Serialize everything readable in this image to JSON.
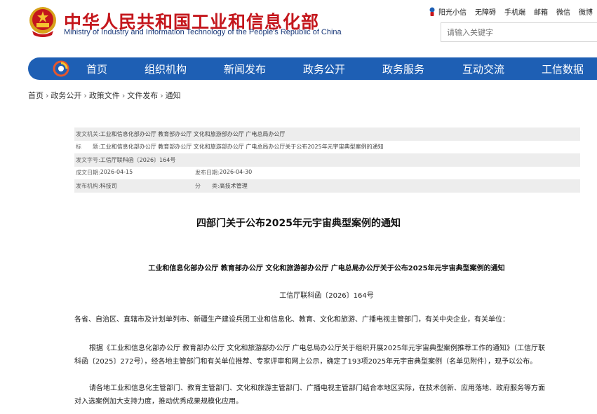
{
  "header": {
    "title_cn": "中华人民共和国工业和信息化部",
    "title_en": "Ministry of Industry and Information Technology of the People's Republic of China",
    "toplinks": [
      "阳光小信",
      "无障碍",
      "手机端",
      "邮箱",
      "微信",
      "微博"
    ],
    "search_placeholder": "请输入关键字"
  },
  "nav": {
    "items": [
      "首页",
      "组织机构",
      "新闻发布",
      "政务公开",
      "政务服务",
      "互动交流",
      "工信数据"
    ]
  },
  "breadcrumb": [
    "首页",
    "政务公开",
    "政策文件",
    "文件发布",
    "通知"
  ],
  "meta": {
    "issuer_label": "发文机关:",
    "issuer": "工业和信息化部办公厅 教育部办公厅 文化和旅游部办公厅 广电总局办公厅",
    "title_label": "标　　题:",
    "title": "工业和信息化部办公厅 教育部办公厅 文化和旅游部办公厅 广电总局办公厅关于公布2025年元宇宙典型案例的通知",
    "docno_label": "发文字号:",
    "docno": "工信厅联科函〔2026〕164号",
    "created_label": "成文日期:",
    "created": "2026-04-15",
    "published_label": "发布日期:",
    "published": "2026-04-30",
    "org_label": "发布机构:",
    "org": "科技司",
    "category_label": "分　　类:",
    "category": "高技术管理"
  },
  "article": {
    "title": "四部门关于公布2025年元宇宙典型案例的通知",
    "subtitle": "工业和信息化部办公厅 教育部办公厅 文化和旅游部办公厅 广电总局办公厅关于公布2025年元宇宙典型案例的通知",
    "docno": "工信厅联科函〔2026〕164号",
    "salutation": "各省、自治区、直辖市及计划单列市、新疆生产建设兵团工业和信息化、教育、文化和旅游、广播电视主管部门，有关中央企业，有关单位：",
    "para1_line1": "根据《工业和信息化部办公厅 教育部办公厅 文化和旅游部办公厅 广电总局办公厅关于组织开展2025年元宇宙典型案例推荐工作的通知》（工信厅联",
    "para1_line2": "科函〔2025〕272号），经各地主管部门和有关单位推荐、专家评审和网上公示，确定了193项2025年元宇宙典型案例（名单见附件），现予以公布。",
    "para2_line1": "请各地工业和信息化主管部门、教育主管部门、文化和旅游主管部门、广播电视主管部门结合本地区实际，在技术创新、应用落地、政府服务等方面",
    "para2_line2": "对入选案例加大支持力度，推动优秀成果规模化应用。"
  }
}
